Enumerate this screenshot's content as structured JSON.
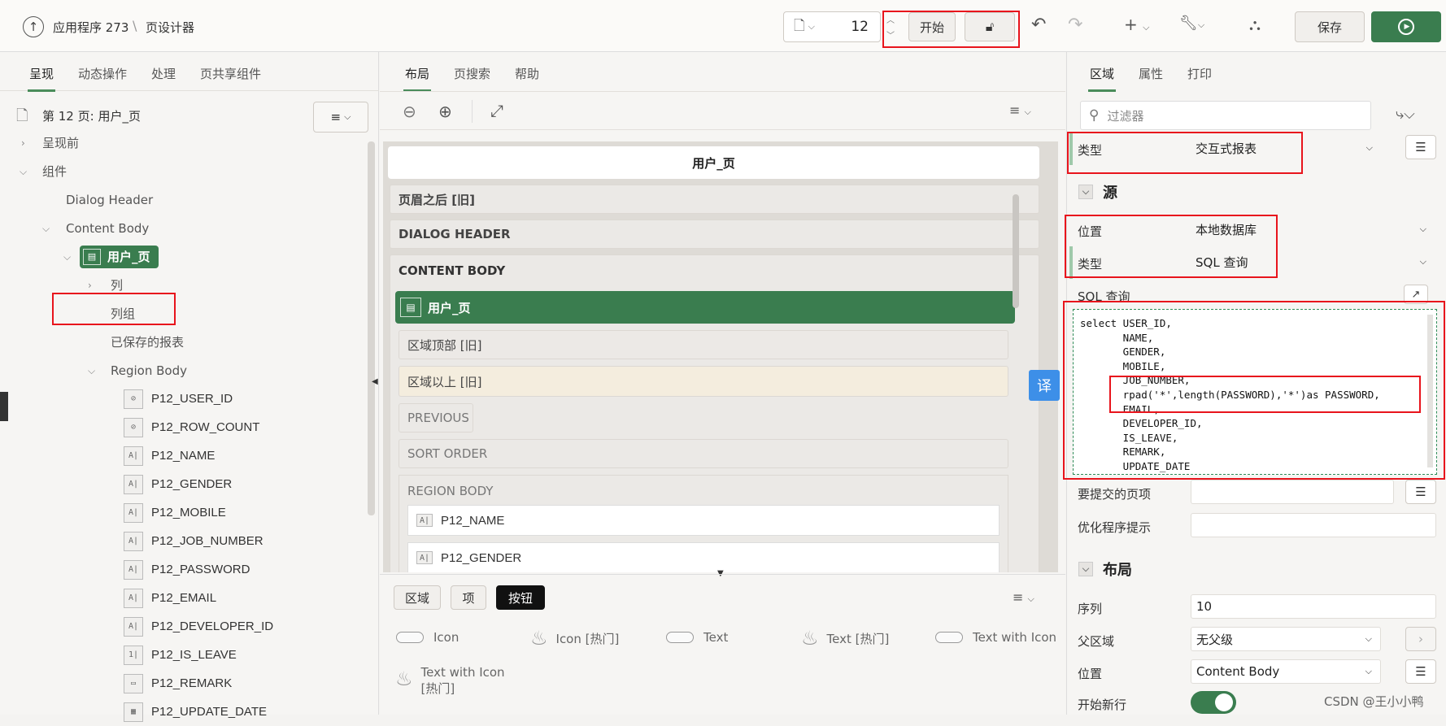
{
  "header": {
    "app_name": "应用程序 273",
    "separator": "\\",
    "page_designer": "页设计器",
    "page_number": "12",
    "start_label": "开始",
    "save_label": "保存"
  },
  "left": {
    "tabs": [
      "呈现",
      "动态操作",
      "处理",
      "页共享组件"
    ],
    "page_title": "第 12 页: 用户_页",
    "tree": {
      "before_render": "呈现前",
      "components": "组件",
      "dialog_header": "Dialog Header",
      "content_body": "Content Body",
      "region": "用户_页",
      "columns": "列",
      "column_groups": "列组",
      "saved_reports": "已保存的报表",
      "region_body": "Region Body"
    },
    "items": [
      {
        "name": "P12_USER_ID",
        "icon": "hidden-icon"
      },
      {
        "name": "P12_ROW_COUNT",
        "icon": "hidden-icon"
      },
      {
        "name": "P12_NAME",
        "icon": "text-field-icon"
      },
      {
        "name": "P12_GENDER",
        "icon": "text-field-icon"
      },
      {
        "name": "P12_MOBILE",
        "icon": "text-field-icon"
      },
      {
        "name": "P12_JOB_NUMBER",
        "icon": "text-field-icon"
      },
      {
        "name": "P12_PASSWORD",
        "icon": "text-field-icon"
      },
      {
        "name": "P12_EMAIL",
        "icon": "text-field-icon"
      },
      {
        "name": "P12_DEVELOPER_ID",
        "icon": "text-field-icon"
      },
      {
        "name": "P12_IS_LEAVE",
        "icon": "number-field-icon"
      },
      {
        "name": "P12_REMARK",
        "icon": "textarea-icon"
      },
      {
        "name": "P12_UPDATE_DATE",
        "icon": "date-picker-icon"
      }
    ]
  },
  "middle": {
    "tabs": [
      "布局",
      "页搜索",
      "帮助"
    ],
    "page_title": "用户_页",
    "after_header": "页眉之后 [旧]",
    "dialog_header": "DIALOG HEADER",
    "content_body": "CONTENT BODY",
    "region_title": "用户_页",
    "region_top": "区域顶部 [旧]",
    "above_region": "区域以上 [旧]",
    "previous": "PREVIOUS",
    "sort_order": "SORT ORDER",
    "region_body": "REGION BODY",
    "item1": "P12_NAME",
    "item2": "P12_GENDER",
    "translate_badge": "译",
    "gallery_tabs": [
      "区域",
      "项",
      "按钮"
    ],
    "gallery": [
      "Icon",
      "Icon [热门]",
      "Text",
      "Text [热门]",
      "Text with Icon",
      "Text with Icon",
      "[热门]"
    ]
  },
  "right": {
    "tabs": [
      "区域",
      "属性",
      "打印"
    ],
    "filter_placeholder": "过滤器",
    "type_label": "类型",
    "type_value": "交互式报表",
    "source_section": "源",
    "location_label": "位置",
    "location_value": "本地数据库",
    "source_type_label": "类型",
    "source_type_value": "SQL 查询",
    "sql_label": "SQL 查询",
    "sql_lines": [
      "select USER_ID,",
      "       NAME,",
      "       GENDER,",
      "       MOBILE,",
      "       JOB_NUMBER,",
      "       rpad('*',length(PASSWORD),'*')as PASSWORD,",
      "       EMAIL,",
      "       DEVELOPER_ID,",
      "       IS_LEAVE,",
      "       REMARK,",
      "       UPDATE_DATE"
    ],
    "submit_items_label": "要提交的页项",
    "optimizer_label": "优化程序提示",
    "layout_section": "布局",
    "sequence_label": "序列",
    "sequence_value": "10",
    "parent_label": "父区域",
    "parent_value": "无父级",
    "position_label": "位置",
    "position_value": "Content Body",
    "new_row_label": "开始新行",
    "new_row_on": true
  },
  "watermark": "CSDN @王小小鸭",
  "colors": {
    "accent_green": "#3a7d4f",
    "highlight_red": "#e8141c",
    "translate_blue": "#3d8fe8"
  }
}
